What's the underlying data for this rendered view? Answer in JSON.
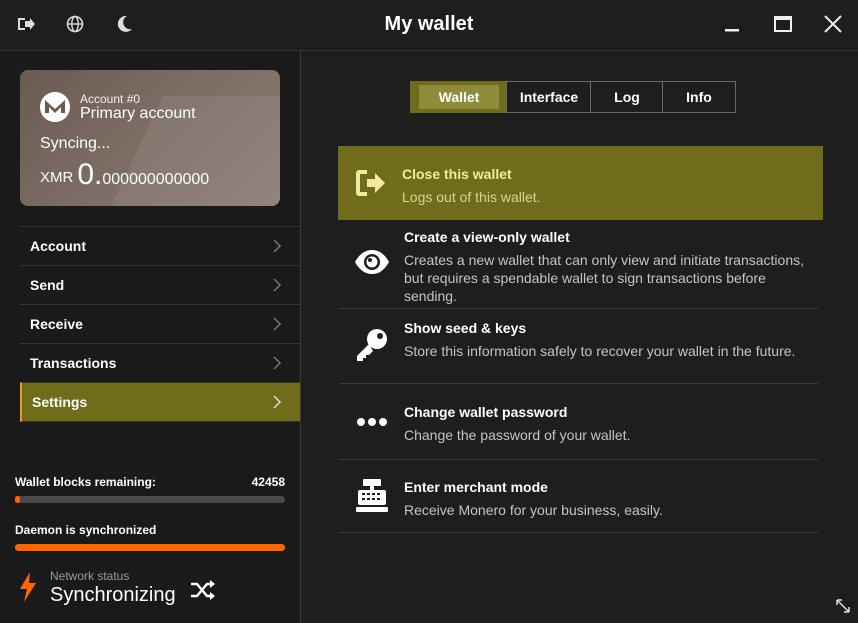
{
  "window": {
    "title": "My wallet",
    "icons": [
      "logout-icon",
      "globe-icon",
      "moon-icon"
    ],
    "controls": [
      "minimize-icon",
      "maximize-icon",
      "close-icon"
    ]
  },
  "account_card": {
    "account_number": "Account #0",
    "account_name": "Primary account",
    "status": "Syncing...",
    "currency": "XMR",
    "balance_int": "0.",
    "balance_dec": "000000000000"
  },
  "sidebar": {
    "items": [
      {
        "label": "Account"
      },
      {
        "label": "Send"
      },
      {
        "label": "Receive"
      },
      {
        "label": "Transactions"
      },
      {
        "label": "Settings",
        "active": true
      }
    ],
    "blocks_label": "Wallet blocks remaining:",
    "blocks_count": "42458",
    "blocks_progress": 0.02,
    "daemon_label": "Daemon is synchronized",
    "daemon_progress": 1.0,
    "network_label": "Network status",
    "network_status": "Synchronizing"
  },
  "tabs": [
    {
      "label": "Wallet",
      "active": true
    },
    {
      "label": "Interface"
    },
    {
      "label": "Log"
    },
    {
      "label": "Info"
    }
  ],
  "settings_items": [
    {
      "title": "Close this wallet",
      "desc": "Logs out of this wallet.",
      "icon": "sign-out-icon"
    },
    {
      "title": "Create a view-only wallet",
      "desc": "Creates a new wallet that can only view and initiate transactions, but requires a spendable wallet to sign transactions before sending.",
      "icon": "eye-icon"
    },
    {
      "title": "Show seed & keys",
      "desc": "Store this information safely to recover your wallet in the future.",
      "icon": "key-icon"
    },
    {
      "title": "Change wallet password",
      "desc": "Change the password of your wallet.",
      "icon": "ellipsis-icon"
    },
    {
      "title": "Enter merchant mode",
      "desc": "Receive Monero for your business, easily.",
      "icon": "cash-register-icon"
    }
  ],
  "colors": {
    "accent": "#6f6d1a",
    "progress": "#ff6600",
    "background": "#1e1e1e"
  }
}
